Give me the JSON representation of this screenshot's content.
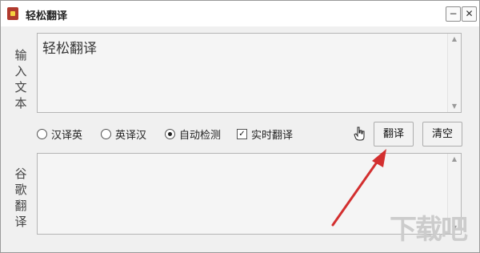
{
  "window": {
    "title": "轻松翻译",
    "minimize_label": "−",
    "close_label": "✕"
  },
  "input": {
    "label_chars": [
      "输",
      "入",
      "文",
      "本"
    ],
    "text": "轻松翻译"
  },
  "output": {
    "label_chars": [
      "谷",
      "歌",
      "翻",
      "译"
    ],
    "text": ""
  },
  "options": {
    "zh_to_en": "汉译英",
    "en_to_zh": "英译汉",
    "auto_detect": "自动检测",
    "realtime": "实时翻译",
    "selected": "auto_detect",
    "realtime_checked": true
  },
  "buttons": {
    "translate": "翻译",
    "clear": "清空"
  },
  "watermark": "下载吧",
  "colors": {
    "annotation_arrow": "#d32f2f"
  },
  "icons": {
    "app": "app-icon",
    "cursor": "hand-cursor-icon"
  }
}
